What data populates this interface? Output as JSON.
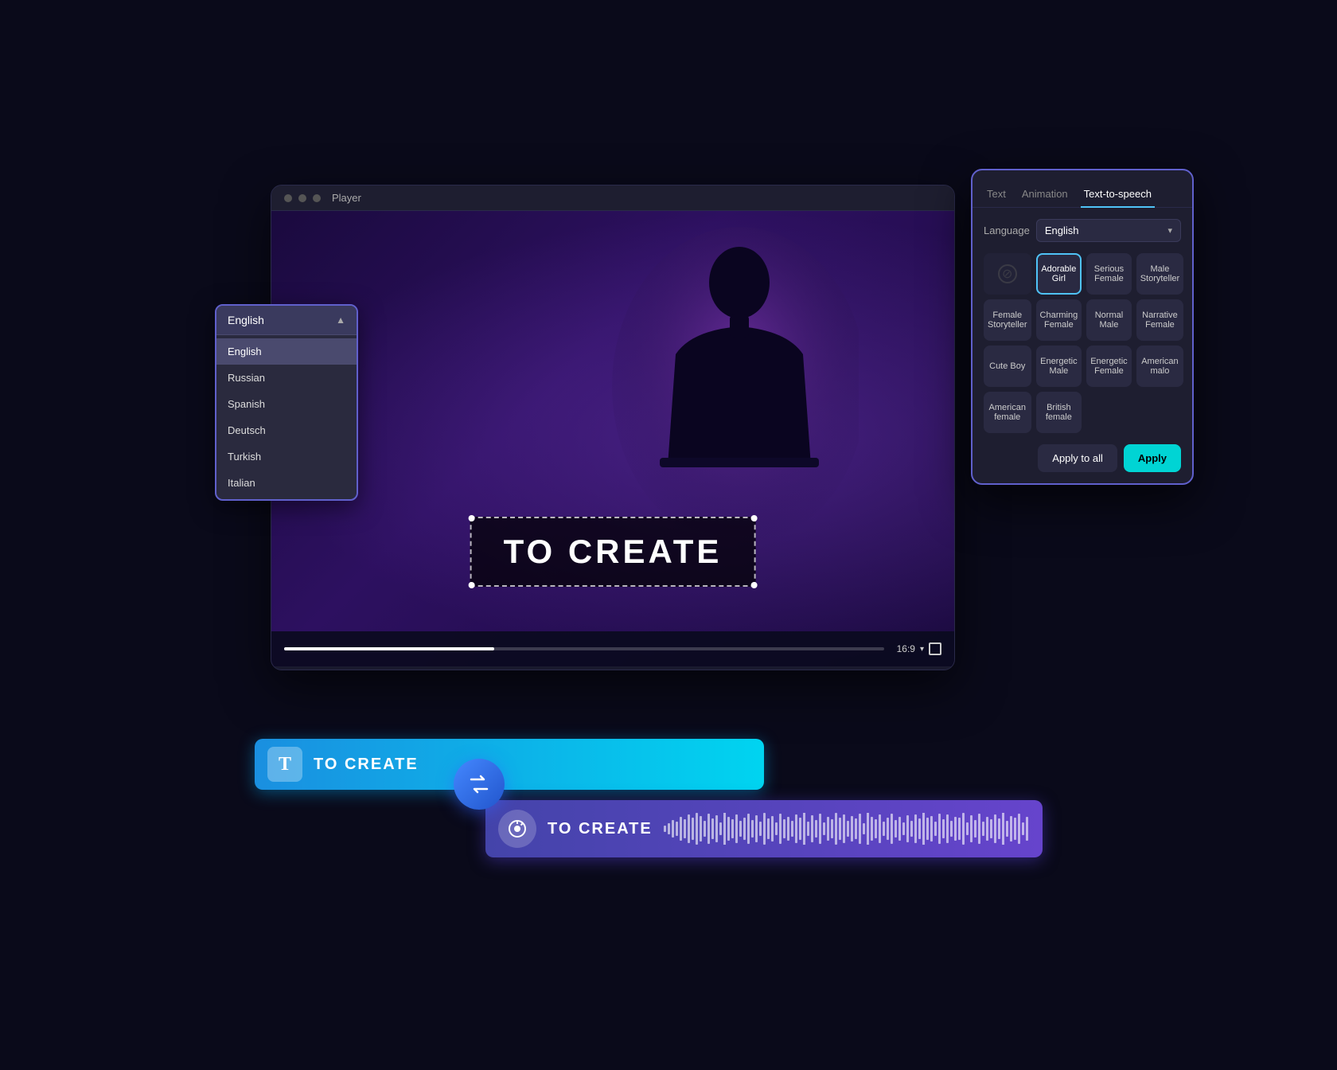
{
  "player": {
    "title": "Player",
    "text_overlay": "TO CREATE",
    "aspect_ratio": "16:9"
  },
  "lang_dropdown": {
    "selected": "English",
    "items": [
      {
        "label": "English",
        "active": true
      },
      {
        "label": "Russian",
        "active": false
      },
      {
        "label": "Spanish",
        "active": false
      },
      {
        "label": "Deutsch",
        "active": false
      },
      {
        "label": "Turkish",
        "active": false
      },
      {
        "label": "Italian",
        "active": false
      }
    ]
  },
  "tts_panel": {
    "tabs": [
      {
        "label": "Text",
        "active": false
      },
      {
        "label": "Animation",
        "active": false
      },
      {
        "label": "Text-to-speech",
        "active": true
      }
    ],
    "language_label": "Language",
    "language_value": "English",
    "voices": [
      {
        "label": "",
        "type": "disabled"
      },
      {
        "label": "Adorable Girl",
        "type": "selected"
      },
      {
        "label": "Serious Female",
        "type": "normal"
      },
      {
        "label": "Male Storyteller",
        "type": "normal"
      },
      {
        "label": "Female Storyteller",
        "type": "normal"
      },
      {
        "label": "Charming Female",
        "type": "normal"
      },
      {
        "label": "Normal Male",
        "type": "normal"
      },
      {
        "label": "Narrative Female",
        "type": "normal"
      },
      {
        "label": "Cute Boy",
        "type": "normal"
      },
      {
        "label": "Energetic Male",
        "type": "normal"
      },
      {
        "label": "Energetic Female",
        "type": "normal"
      },
      {
        "label": "American malo",
        "type": "normal"
      },
      {
        "label": "American female",
        "type": "normal"
      },
      {
        "label": "British female",
        "type": "normal"
      }
    ],
    "apply_all_label": "Apply to all",
    "apply_label": "Apply"
  },
  "text_track": {
    "icon": "T",
    "label": "TO CREATE"
  },
  "audio_track": {
    "label": "TO CREATE"
  }
}
